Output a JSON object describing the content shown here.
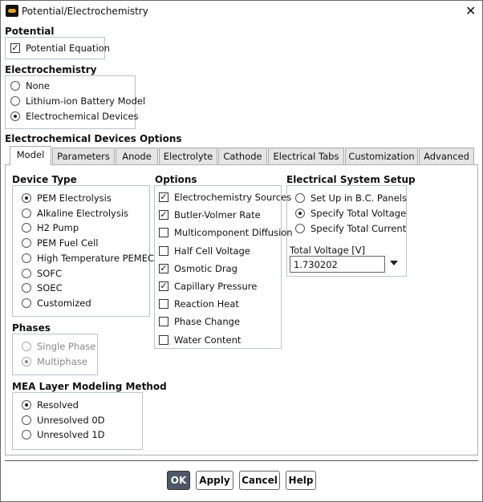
{
  "window": {
    "title": "Potential/Electrochemistry",
    "icon": "ansys-fluent-logo-icon",
    "close": "✕"
  },
  "potential": {
    "label": "Potential",
    "equation": {
      "label": "Potential Equation",
      "checked": true
    }
  },
  "electrochemistry": {
    "label": "Electrochemistry",
    "options": [
      {
        "label": "None",
        "selected": false
      },
      {
        "label": "Lithium-ion Battery Model",
        "selected": false
      },
      {
        "label": "Electrochemical Devices",
        "selected": true
      }
    ]
  },
  "devices": {
    "label": "Electrochemical Devices Options",
    "tabs": [
      {
        "label": "Model",
        "selected": true
      },
      {
        "label": "Parameters"
      },
      {
        "label": "Anode"
      },
      {
        "label": "Electrolyte"
      },
      {
        "label": "Cathode"
      },
      {
        "label": "Electrical Tabs"
      },
      {
        "label": "Customization"
      },
      {
        "label": "Advanced"
      }
    ],
    "device_type": {
      "label": "Device Type",
      "options": [
        {
          "label": "PEM Electrolysis",
          "selected": true
        },
        {
          "label": "Alkaline Electrolysis"
        },
        {
          "label": "H2 Pump"
        },
        {
          "label": "PEM Fuel Cell"
        },
        {
          "label": "High Temperature PEMEC"
        },
        {
          "label": "SOFC"
        },
        {
          "label": "SOEC"
        },
        {
          "label": "Customized"
        }
      ]
    },
    "phases": {
      "label": "Phases",
      "disabled": true,
      "options": [
        {
          "label": "Single Phase"
        },
        {
          "label": "Multiphase",
          "selected": true
        }
      ]
    },
    "mea": {
      "label": "MEA Layer Modeling Method",
      "options": [
        {
          "label": "Resolved",
          "selected": true
        },
        {
          "label": "Unresolved 0D"
        },
        {
          "label": "Unresolved 1D"
        }
      ]
    },
    "options": {
      "label": "Options",
      "items": [
        {
          "label": "Electrochemistry Sources",
          "checked": true
        },
        {
          "label": "Butler-Volmer Rate",
          "checked": true
        },
        {
          "label": "Multicomponent Diffusion",
          "checked": false
        },
        {
          "label": "Half Cell Voltage",
          "checked": false
        },
        {
          "label": "Osmotic Drag",
          "checked": true
        },
        {
          "label": "Capillary Pressure",
          "checked": true
        },
        {
          "label": "Reaction Heat",
          "checked": false
        },
        {
          "label": "Phase Change",
          "checked": false
        },
        {
          "label": "Water Content",
          "checked": false
        }
      ]
    },
    "electrical": {
      "label": "Electrical System Setup",
      "options": [
        {
          "label": "Set Up in B.C. Panels"
        },
        {
          "label": "Specify Total Voltage",
          "selected": true
        },
        {
          "label": "Specify Total Current"
        }
      ],
      "voltage_label": "Total Voltage [V]",
      "voltage_value": "1.730202"
    }
  },
  "buttons": {
    "ok": "OK",
    "apply": "Apply",
    "cancel": "Cancel",
    "help": "Help"
  }
}
